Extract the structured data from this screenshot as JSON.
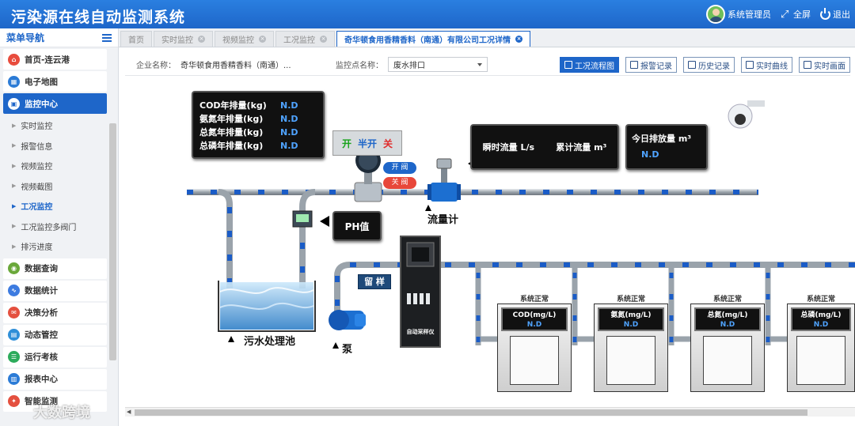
{
  "app": {
    "title": "污染源在线自动监测系统"
  },
  "header": {
    "user": "系统管理员",
    "fullscreen": "全屏",
    "logout": "退出"
  },
  "sidebar": {
    "title": "菜单导航",
    "groups": [
      {
        "label": "首页-连云港",
        "color": "#e84c3d"
      },
      {
        "label": "电子地图",
        "color": "#2b7bd6"
      },
      {
        "label": "监控中心",
        "color": "#ffffff"
      },
      {
        "label": "数据查询",
        "color": "#6aa83a"
      },
      {
        "label": "数据统计",
        "color": "#3d7be0"
      },
      {
        "label": "决策分析",
        "color": "#e4503f"
      },
      {
        "label": "动态管控",
        "color": "#2f8fd8"
      },
      {
        "label": "运行考核",
        "color": "#2cab5b"
      },
      {
        "label": "报表中心",
        "color": "#2b7bd6"
      },
      {
        "label": "智能监测",
        "color": "#e4503f"
      }
    ],
    "sub_items": [
      "实时监控",
      "报警信息",
      "视频监控",
      "视频截图",
      "工况监控",
      "工况监控多阀门",
      "排污进度"
    ]
  },
  "tabs": [
    {
      "label": "首页"
    },
    {
      "label": "实时监控"
    },
    {
      "label": "视频监控"
    },
    {
      "label": "工况监控"
    },
    {
      "label": "奇华顿食用香精香料（南通）有限公司工况详情"
    }
  ],
  "filter": {
    "company_label": "企业名称：",
    "company_value": "奇华顿食用香精香料（南通）...",
    "point_label": "监控点名称：",
    "point_value": "废水排口"
  },
  "buttons": {
    "flow": "工况流程图",
    "alarm": "报警记录",
    "history": "历史记录",
    "curve": "实时曲线",
    "screen": "实时画面"
  },
  "diagram": {
    "annual": [
      {
        "label": "COD年排量(kg)",
        "value": "N.D"
      },
      {
        "label": "氨氮年排量(kg)",
        "value": "N.D"
      },
      {
        "label": "总氮年排量(kg)",
        "value": "N.D"
      },
      {
        "label": "总磷年排量(kg)",
        "value": "N.D"
      }
    ],
    "valve": {
      "open": "开",
      "half": "半开",
      "close": "关",
      "open_btn": "开 阀",
      "close_btn": "关 阀"
    },
    "flow_panel": {
      "instant": "瞬时流量 L/s",
      "total": "累计流量 m³"
    },
    "daily": {
      "label": "今日排放量",
      "unit": "m³",
      "value": "N.D"
    },
    "ph": "PH值",
    "flowmeter": "流量计",
    "pool": "污水处理池",
    "pump": "泵",
    "sample_btn": "留 样",
    "sampler": "自动采样仪",
    "watermark": "大数跨境",
    "analyzers": [
      {
        "status": "系统正常",
        "name": "COD(mg/L)",
        "value": "N.D"
      },
      {
        "status": "系统正常",
        "name": "氨氮(mg/L)",
        "value": "N.D"
      },
      {
        "status": "系统正常",
        "name": "总氮(mg/L)",
        "value": "N.D"
      },
      {
        "status": "系统正常",
        "name": "总磷(mg/L)",
        "value": "N.D"
      }
    ]
  }
}
